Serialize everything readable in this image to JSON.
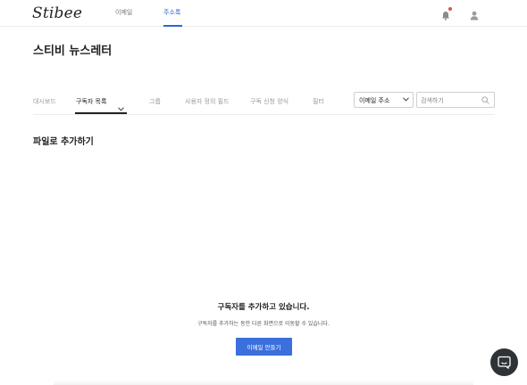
{
  "app": {
    "logo_text": "Stibee",
    "brand_color": "#2f66d8"
  },
  "topnav": {
    "items": [
      {
        "label": "이메일",
        "active": false
      },
      {
        "label": "주소록",
        "active": true
      }
    ],
    "icons": [
      "bell-icon",
      "user-icon"
    ]
  },
  "page": {
    "title": "스티비 뉴스레터"
  },
  "subtabs": [
    {
      "label": "대시보드",
      "active": false
    },
    {
      "label": "구독자 목록",
      "active": true
    },
    {
      "label": "그룹",
      "active": false
    },
    {
      "label": "사용자 정의 필드",
      "active": false
    },
    {
      "label": "구독 신청 양식",
      "active": false
    },
    {
      "label": "필터",
      "active": false
    }
  ],
  "filter": {
    "select_value": "이메일 주소",
    "search_placeholder": "검색하기"
  },
  "section": {
    "title": "파일로 추가하기"
  },
  "notice": {
    "title": "구독자를 추가하고 있습니다.",
    "description": "구독자를 추가하는 동안 다른 화면으로 이동할 수 있습니다.",
    "button_label": "이메일 만들기",
    "button_color": "#3b6fdc"
  },
  "chat": {
    "icon": "chat-icon"
  }
}
